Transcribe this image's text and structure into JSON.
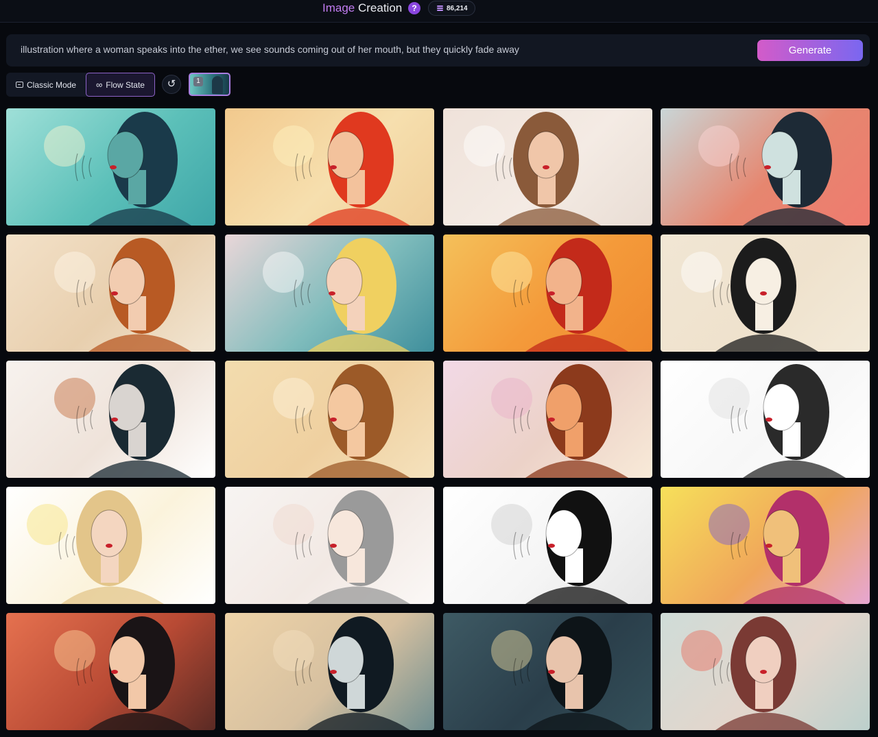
{
  "header": {
    "title_part1": "Image",
    "title_part2": "Creation",
    "help_label": "?",
    "credits": "86,214",
    "help_icon": "question-icon",
    "credits_icon": "coins-icon"
  },
  "prompt": {
    "text": "illustration where a woman speaks into the ether, we see sounds coming out of her mouth, but they quickly fade away",
    "generate_label": "Generate"
  },
  "toolbar": {
    "classic_mode_label": "Classic Mode",
    "flow_state_label": "Flow State",
    "reset_icon": "refresh-icon",
    "history_badge": "1"
  },
  "gallery": {
    "images": [
      {
        "bg": "linear-gradient(135deg,#9fe0d8,#5cc0b9 55%,#3ea6a8)",
        "hair": "#1a3a4a",
        "skin": "#5aa7a4",
        "face": "right",
        "accent": "#fff6d0"
      },
      {
        "bg": "linear-gradient(135deg,#f2c98d,#f6dfae 55%,#f0cf9a)",
        "hair": "#e0391f",
        "skin": "#f3c29c",
        "face": "left",
        "accent": "#fff4c4"
      },
      {
        "bg": "linear-gradient(135deg,#efe2da,#f4ebe4 55%,#e9ddd4)",
        "hair": "#8a5a3a",
        "skin": "#f0c6a9",
        "face": "front",
        "accent": "#ffffff"
      },
      {
        "bg": "linear-gradient(135deg,#c9d6d7,#e6866f 55%,#ef7b6f)",
        "hair": "#1d2a36",
        "skin": "#cfe1df",
        "face": "right",
        "accent": "#ffd6d6"
      },
      {
        "bg": "linear-gradient(135deg,#f3e1c8,#e8cfae 55%,#f2e6d3)",
        "hair": "#b85a24",
        "skin": "#f2ccb0",
        "face": "left",
        "accent": "#fff8ea"
      },
      {
        "bg": "linear-gradient(135deg,#e9d6d8,#7fbcbc 55%,#3f8f9c)",
        "hair": "#f0d060",
        "skin": "#f4d2bb",
        "face": "right",
        "accent": "#ffffff"
      },
      {
        "bg": "linear-gradient(135deg,#f4c05a,#f49a3a 55%,#ef8a30)",
        "hair": "#c32a1a",
        "skin": "#f2b38b",
        "face": "left",
        "accent": "#fff0b0"
      },
      {
        "bg": "linear-gradient(135deg,#f1e6d4,#efe2cd 55%,#f3ead9)",
        "hair": "#1c1c1c",
        "skin": "#f7efe3",
        "face": "front",
        "accent": "#ffffff"
      },
      {
        "bg": "linear-gradient(135deg,#f7f2ee,#efe3da 55%,#ffffff)",
        "hair": "#1a2a33",
        "skin": "#d9d4d0",
        "face": "left",
        "accent": "#c46a3a"
      },
      {
        "bg": "linear-gradient(135deg,#f3dcae,#efd0a0 55%,#f5e2bd)",
        "hair": "#9c5a28",
        "skin": "#f4c8a0",
        "face": "left",
        "accent": "#fff3dd"
      },
      {
        "bg": "linear-gradient(135deg,#f2d9e6,#ecd2c8 55%,#f8ead8)",
        "hair": "#8c3a1c",
        "skin": "#f0a06a",
        "face": "left",
        "accent": "#e9b0c8"
      },
      {
        "bg": "linear-gradient(135deg,#ffffff,#f7f7f7 55%,#ffffff)",
        "hair": "#2a2a2a",
        "skin": "#ffffff",
        "face": "left",
        "accent": "#dddddd"
      },
      {
        "bg": "linear-gradient(135deg,#ffffff,#fbf3dc 55%,#ffffff)",
        "hair": "#e3c58a",
        "skin": "#f4d6c0",
        "face": "front",
        "accent": "#f7e27a"
      },
      {
        "bg": "linear-gradient(135deg,#f7f4f2,#f2e9e4 55%,#fbf8f6)",
        "hair": "#9a9a9a",
        "skin": "#f7e7dc",
        "face": "left",
        "accent": "#f0d6cc"
      },
      {
        "bg": "linear-gradient(135deg,#ffffff,#f5f5f5 55%,#e6e6e6)",
        "hair": "#111111",
        "skin": "#ffffff",
        "face": "left",
        "accent": "#cccccc"
      },
      {
        "bg": "linear-gradient(135deg,#f6e05a,#f0a65a 55%,#e6a6d2)",
        "hair": "#b2306a",
        "skin": "#f0c07a",
        "face": "left",
        "accent": "#7a5ad0"
      },
      {
        "bg": "linear-gradient(135deg,#e5714f,#b84a34 55%,#5a2a24)",
        "hair": "#1a1416",
        "skin": "#f2c8a8",
        "face": "left",
        "accent": "#ffd6a0"
      },
      {
        "bg": "linear-gradient(135deg,#eed3a8,#d6c0a0 55%,#6f8e90)",
        "hair": "#101a22",
        "skin": "#cfd7d8",
        "face": "left",
        "accent": "#f4e0c0"
      },
      {
        "bg": "linear-gradient(135deg,#3e5a64,#2a3e4a 55%,#34505a)",
        "hair": "#0d1418",
        "skin": "#e8c4ac",
        "face": "left",
        "accent": "#f0dca0"
      },
      {
        "bg": "linear-gradient(135deg,#cfdcd8,#e3d6cc 55%,#bcd0cc)",
        "hair": "#7a3a34",
        "skin": "#f0cfc0",
        "face": "front",
        "accent": "#e86a5a"
      }
    ]
  }
}
